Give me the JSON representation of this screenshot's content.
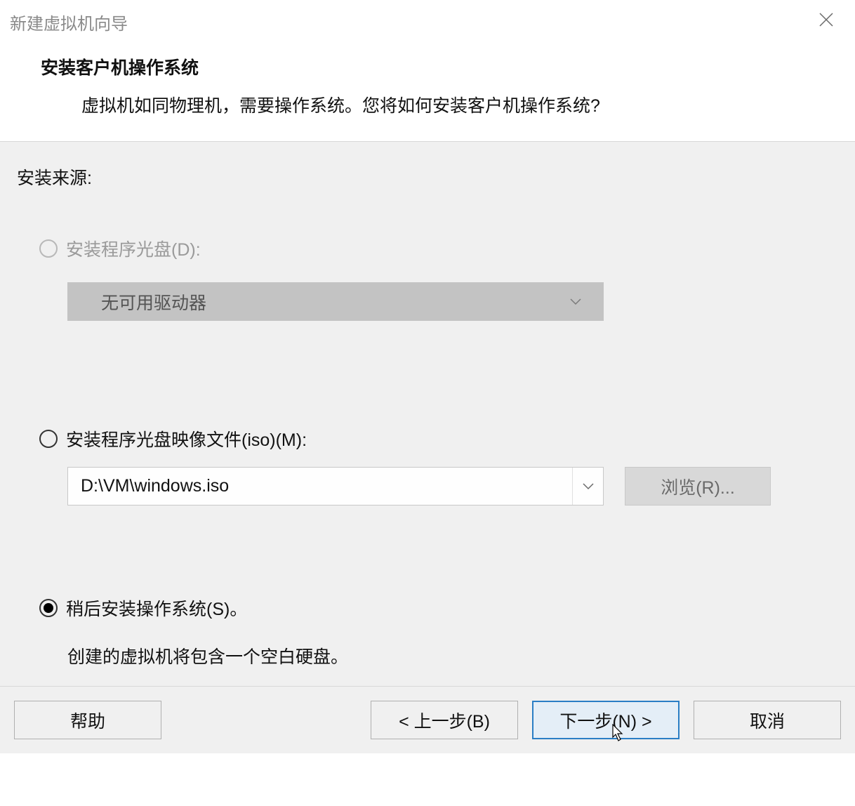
{
  "window": {
    "title": "新建虚拟机向导"
  },
  "header": {
    "title": "安装客户机操作系统",
    "description": "虚拟机如同物理机，需要操作系统。您将如何安装客户机操作系统?"
  },
  "source": {
    "label": "安装来源:",
    "options": {
      "disc": {
        "label": "安装程序光盘(D):",
        "dropdown_value": "无可用驱动器"
      },
      "iso": {
        "label": "安装程序光盘映像文件(iso)(M):",
        "path": "D:\\VM\\windows.iso",
        "browse_label": "浏览(R)..."
      },
      "later": {
        "label": "稍后安装操作系统(S)。",
        "description": "创建的虚拟机将包含一个空白硬盘。"
      }
    }
  },
  "footer": {
    "help": "帮助",
    "back": "< 上一步(B)",
    "next": "下一步(N) >",
    "cancel": "取消"
  }
}
